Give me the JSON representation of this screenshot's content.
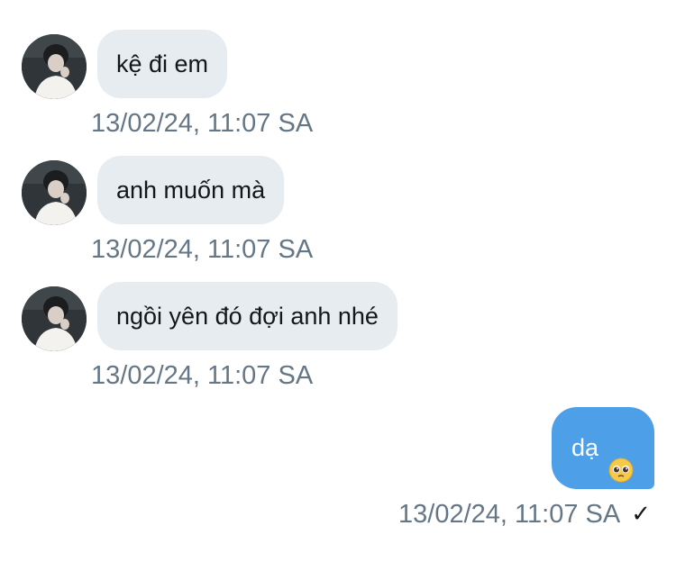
{
  "messages": [
    {
      "text": "kệ đi em",
      "time": "13/02/24, 11:07 SA",
      "direction": "incoming"
    },
    {
      "text": "anh muốn mà",
      "time": "13/02/24, 11:07 SA",
      "direction": "incoming"
    },
    {
      "text": "ngồi yên đó đợi anh nhé",
      "time": "13/02/24, 11:07 SA",
      "direction": "incoming"
    },
    {
      "text": "dạ",
      "emoji": "pleading-face-emoji",
      "time": "13/02/24, 11:07 SA",
      "direction": "outgoing",
      "status": "✓"
    }
  ],
  "colors": {
    "incoming_bubble": "#e6ecf0",
    "outgoing_bubble": "#4d9fe8",
    "timestamp": "#657786"
  },
  "icons": {
    "avatar": "user-avatar",
    "status": "check-icon"
  }
}
